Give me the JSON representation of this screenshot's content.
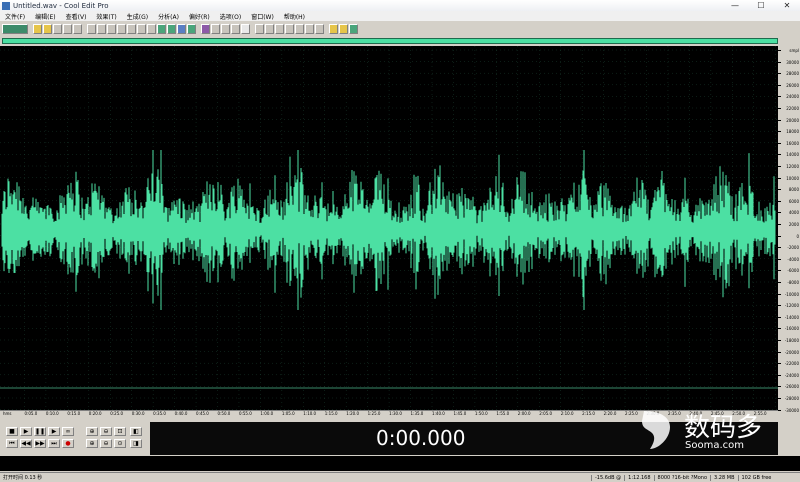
{
  "window": {
    "title": "Untitled.wav - Cool Edit Pro",
    "controls": [
      "—",
      "☐",
      "✕"
    ]
  },
  "menu": [
    "文件(F)",
    "编辑(E)",
    "查看(V)",
    "效果(T)",
    "生成(G)",
    "分析(A)",
    "偏好(R)",
    "选项(O)",
    "窗口(W)",
    "帮助(H)"
  ],
  "amplitude_scale": [
    "smpl",
    "30000",
    "28000",
    "26000",
    "24000",
    "22000",
    "20000",
    "18000",
    "16000",
    "14000",
    "12000",
    "10000",
    "8000",
    "6000",
    "4000",
    "2000",
    "0",
    "-2000",
    "-4000",
    "-6000",
    "-8000",
    "-10000",
    "-12000",
    "-14000",
    "-16000",
    "-18000",
    "-20000",
    "-22000",
    "-24000",
    "-26000",
    "-28000",
    "-30000"
  ],
  "time_ruler": [
    "hms",
    "0:05.0",
    "0:10.0",
    "0:15.0",
    "0:20.0",
    "0:25.0",
    "0:30.0",
    "0:35.0",
    "0:40.0",
    "0:45.0",
    "0:50.0",
    "0:55.0",
    "1:00.0",
    "1:05.0",
    "1:10.0",
    "1:15.0",
    "1:20.0",
    "1:25.0",
    "1:30.0",
    "1:35.0",
    "1:40.0",
    "1:45.0",
    "1:50.0",
    "1:55.0",
    "2:00.0",
    "2:05.0",
    "2:10.0",
    "2:15.0",
    "2:20.0",
    "2:25.0",
    "2:30.0",
    "2:35.0",
    "2:40.0",
    "2:45.0",
    "2:50.0",
    "2:55.0"
  ],
  "time_display": "0:00.000",
  "status": {
    "left": "打开时间 0.13 秒",
    "db": "-15.6dB @",
    "time": "1:12.168",
    "format": "8000 ?16-bit ?Mono",
    "size": "3.28 MB",
    "free": "102 GB free"
  },
  "watermark": {
    "cn": "数码多",
    "en": "Sooma.com"
  },
  "colors": {
    "waveform": "#4ce0a3",
    "background": "#000000",
    "grid": "#1f4a38"
  }
}
